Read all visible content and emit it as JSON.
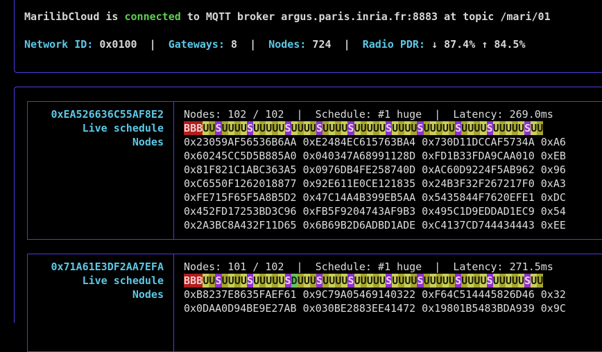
{
  "status": {
    "app": "MarilibCloud",
    "text1": " is ",
    "state": "connected",
    "text2": " to MQTT broker argus.paris.inria.fr:8883 at topic /mari/01"
  },
  "stats": {
    "network_label": "Network ID:",
    "network_value": " 0x0100",
    "sep": "  |  ",
    "gateways_label": "Gateways:",
    "gateways_value": " 8",
    "nodes_label": "Nodes:",
    "nodes_value": " 724",
    "pdr_label": "Radio PDR:",
    "pdr_value": " ↓ 87.4% ↑ 84.5%"
  },
  "gateways": [
    {
      "id": "0xEA526636C55AF8E2",
      "live": "Live schedule",
      "nodes_title": "Nodes",
      "summary": "Nodes: 102 / 102  |  Schedule: #1 huge  |  Latency: 269.0ms",
      "schedule": "BBBUUSUUUUSUUUUUSUUUUSUUUUSUUUUUSUUUUSUUUUUSUUUUSUUUUUSUU",
      "node_rows": [
        "0x23059AF56536B6AA 0xE2484EC615763BA4 0x730D11DCCAF5734A 0xA6",
        "0x60245CC5D5B885A0 0x040347A68991128D 0xFD1B33FDA9CAA010 0xEB",
        "0x81F821C1ABC363A5 0x0976DB4FE258740D 0xAC60D9224F5AB962 0x96",
        "0xC6550F1262018877 0x92E611E0CE121835 0x24B3F32F267217F0 0xA3",
        "0xFE715F65F5A8B5D2 0x47C14A4B399EB5AA 0x5435844F7620EFE1 0xDC",
        "0x452FD17253BD3C96 0xFB5F9204743AF9B3 0x495C1D9EDDAD1EC9 0x54",
        "0x2A3BC8A432F11D65 0x6B69B2D6ADBD1ADE 0xC4137CD744434443 0xEE"
      ]
    },
    {
      "id": "0x71A61E3DF2AA7EFA",
      "live": "Live schedule",
      "nodes_title": "Nodes",
      "summary": "Nodes: 101 / 102  |  Schedule: #1 huge  |  Latency: 271.5ms",
      "schedule": "BBBUUSUUUUSUUUUUSDUUUSUUUUSUUUUUSUUUUSUUUUUSUUUUSUUUUUSUU",
      "node_rows": [
        "0xB8237E8635FAEF61 0x9C79A05469140322 0xF64C514445826D46 0x32",
        "0x0DAA0D94BE9E27AB 0x030BE2883EE41472 0x19801B5483BDA939 0x9C"
      ]
    }
  ]
}
